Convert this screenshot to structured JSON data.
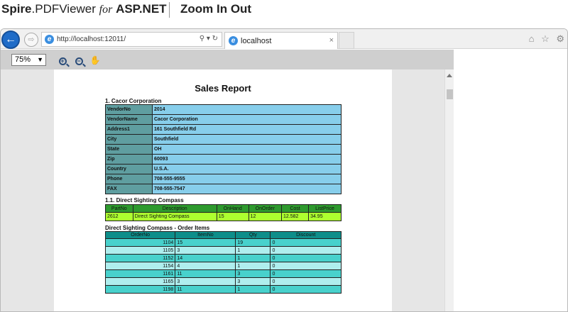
{
  "banner": {
    "brand_bold": "Spire",
    "brand_rest": ".PDFViewer",
    "brand_for": "for",
    "brand_asp": "ASP.NET",
    "title": "Zoom In Out"
  },
  "browser": {
    "url": "http://localhost:12011/",
    "address_controls": "⚲ ▾ ↻",
    "tab_label": "localhost",
    "tab_close": "×",
    "back_glyph": "←",
    "forward_glyph": "⇨",
    "right_icons": [
      "⌂",
      "☆",
      "⚙"
    ]
  },
  "viewer": {
    "zoom_value": "75%",
    "zoom_options": [
      "75%"
    ],
    "icons": [
      "zoom-in-icon",
      "zoom-out-icon",
      "hand-pan-icon"
    ]
  },
  "report": {
    "title": "Sales Report",
    "vendor_heading": "1. Cacor Corporation",
    "vendor": [
      {
        "label": "VendorNo",
        "value": "2014"
      },
      {
        "label": "VendorName",
        "value": "Cacor Corporation"
      },
      {
        "label": "Address1",
        "value": "161 Southfield Rd"
      },
      {
        "label": "City",
        "value": "Southfield"
      },
      {
        "label": "State",
        "value": "OH"
      },
      {
        "label": "Zip",
        "value": "60093"
      },
      {
        "label": "Country",
        "value": "U.S.A."
      },
      {
        "label": "Phone",
        "value": "708-555-9555"
      },
      {
        "label": "FAX",
        "value": "708-555-7547"
      }
    ],
    "part_heading": "1.1. Direct Sighting Compass",
    "part_columns": [
      "PartNo",
      "Description",
      "OnHand",
      "OnOrder",
      "Cost",
      "ListPrice"
    ],
    "part_row": [
      "2612",
      "Direct Sighting Compass",
      "15",
      "12",
      "12.582",
      "34.95"
    ],
    "orders_heading": "Direct Sighting Compass - Order Items",
    "order_columns": [
      "OrderNo",
      "ItemNo",
      "Qty",
      "Discount"
    ],
    "orders": [
      [
        "1104",
        "15",
        "19",
        "0"
      ],
      [
        "1105",
        "3",
        "1",
        "0"
      ],
      [
        "1152",
        "14",
        "1",
        "0"
      ],
      [
        "1154",
        "4",
        "1",
        "0"
      ],
      [
        "1161",
        "11",
        "3",
        "0"
      ],
      [
        "1165",
        "3",
        "3",
        "0"
      ],
      [
        "1198",
        "11",
        "1",
        "0"
      ]
    ]
  },
  "colors": {
    "vendor_label_bg": "#5f9ea0",
    "vendor_value_bg": "#87ceeb",
    "part_header_bg": "#2e9a2e",
    "part_row_bg": "#adff2f",
    "order_header_bg": "#0e8e8a",
    "order_row_odd": "#48d1cc",
    "order_row_even": "#afeeee",
    "back_button": "#1f6cc8"
  }
}
